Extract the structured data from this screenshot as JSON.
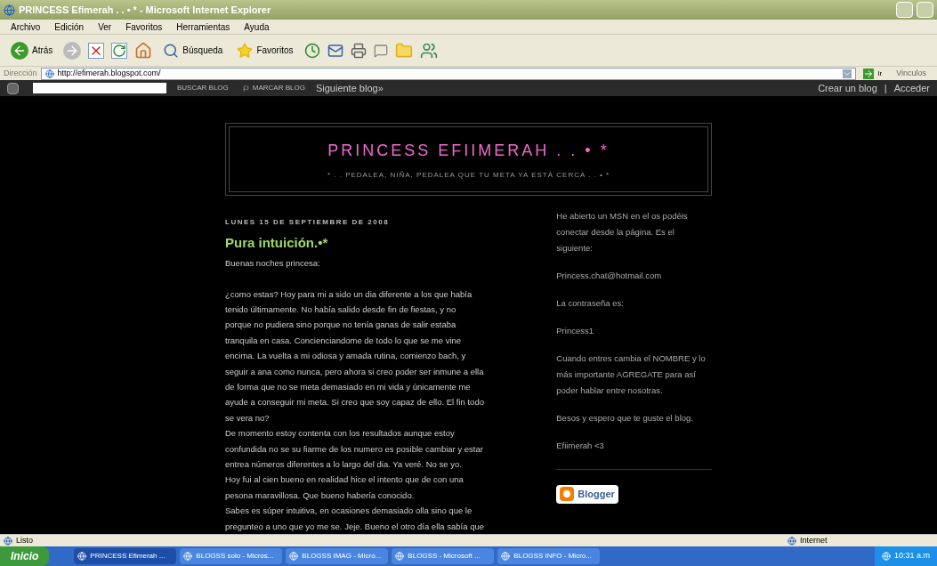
{
  "window": {
    "title": "PRINCESS Efimerah . . • * - Microsoft Internet Explorer"
  },
  "menu": [
    "Archivo",
    "Edición",
    "Ver",
    "Favoritos",
    "Herramientas",
    "Ayuda"
  ],
  "toolbar": {
    "back": "Atrás",
    "search": "Búsqueda",
    "favorites": "Favoritos"
  },
  "address": {
    "label": "Dirección",
    "value": "http://efimerah.blogspot.com/",
    "go": "Ir",
    "links": "Vinculos"
  },
  "navbar": {
    "search_button": "BUSCAR BLOG",
    "flag_button": "MARCAR BLOG",
    "next": "Siguiente blog»",
    "create": "Crear un blog",
    "separator": "|",
    "login": "Acceder"
  },
  "header": {
    "title": "PRINCESS EFIIMERAH . . • *",
    "description": "* . . PEDALEA, NIÑA, PEDALEA QUE TU META YA ESTÁ CERCA . . • *"
  },
  "post": {
    "date": "LUNES 15 DE SEPTIEMBRE DE 2008",
    "title": "Pura intuición.•*",
    "greeting": "Buenas noches princesa:",
    "lines": [
      "¿como estas? Hoy para mi a sido un dia diferente a los que había",
      "tenido últimamente. No había salido desde fin de fiestas, y no",
      "porque no pudiera sino porque no tenía ganas de salir estaba",
      "tranquila en casa. Concienciandome de todo lo que se me vine",
      "encima. La vuelta a mi odiosa y amada rutina, comienzo bach, y",
      "seguir a ana como nunca, pero ahora si creo poder ser inmune a ella",
      "de forma que no se meta demasiado en mi vida y únicamente me",
      "ayude a conseguir mi meta. Si creo que soy capaz de ello. El fin todo",
      "se vera no?",
      "De momento estoy contenta con los resultados aunque estoy",
      "confundida no se su fiarme de los numero es posible cambiar y estar",
      "entrea números diferentes a lo largo del dia. Ya veré. No se yo.",
      "Hoy fui al cien bueno en realidad hice el intento que de con una",
      "pesona maravillosa. Que bueno habería conocido.",
      "Sabes es súper intuitiva, en ocasiones demasiado olla sino que le",
      "pregunteo a uno que yo me se. Jeje. Bueno el otro día ella sabía que"
    ]
  },
  "sidebar": {
    "paragraphs": [
      "He abierto un MSN en el os podéis conectar desde la página. Es el siguiente:",
      "Princess.chat@hotmail.com",
      "La contraseña es:",
      "Princess1",
      "Cuando entres cambia el NOMBRE y lo más importante AGREGATE para así poder hablar entre nosotras.",
      "Besos y espero que te guste el blog.",
      "Efiimerah <3"
    ],
    "badge": "Blogger"
  },
  "status_bar": {
    "text": "Listo",
    "zone": "Internet"
  },
  "taskbar": {
    "start": "Inicio",
    "tasks": [
      {
        "label": "PRINCESS Efimerah ...",
        "selected": true
      },
      {
        "label": "BLOGSS solo - Micros...",
        "selected": false
      },
      {
        "label": "BLOGSS IMAG - Micro...",
        "selected": false
      },
      {
        "label": "BLOGSS - Microsoft ...",
        "selected": false
      },
      {
        "label": "BLOGSS INFO - Micro...",
        "selected": false
      }
    ],
    "clock": "10:31 a.m"
  }
}
